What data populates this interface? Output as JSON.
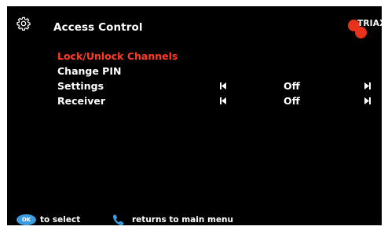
{
  "header": {
    "title": "Access Control",
    "settings_icon": "gear-icon"
  },
  "brand": {
    "name": "TRIAX",
    "color": "#e8331c"
  },
  "menu": {
    "items": [
      {
        "label": "Lock/Unlock Channels",
        "selected": true
      },
      {
        "label": "Change PIN",
        "selected": false
      },
      {
        "label": "Settings",
        "value": "Off",
        "prev_icon": "skip-previous-icon",
        "next_icon": "skip-next-icon"
      },
      {
        "label": "Receiver",
        "value": "Off",
        "prev_icon": "skip-previous-icon",
        "next_icon": "skip-next-icon"
      }
    ]
  },
  "footer": {
    "ok_label": "OK",
    "select_hint": "to select",
    "back_icon": "phone-handset-icon",
    "back_hint": "returns to main menu"
  },
  "colors": {
    "background": "#000000",
    "highlight": "#ff3b22",
    "text": "#ffffff",
    "ok_button": "#3d9be0"
  }
}
